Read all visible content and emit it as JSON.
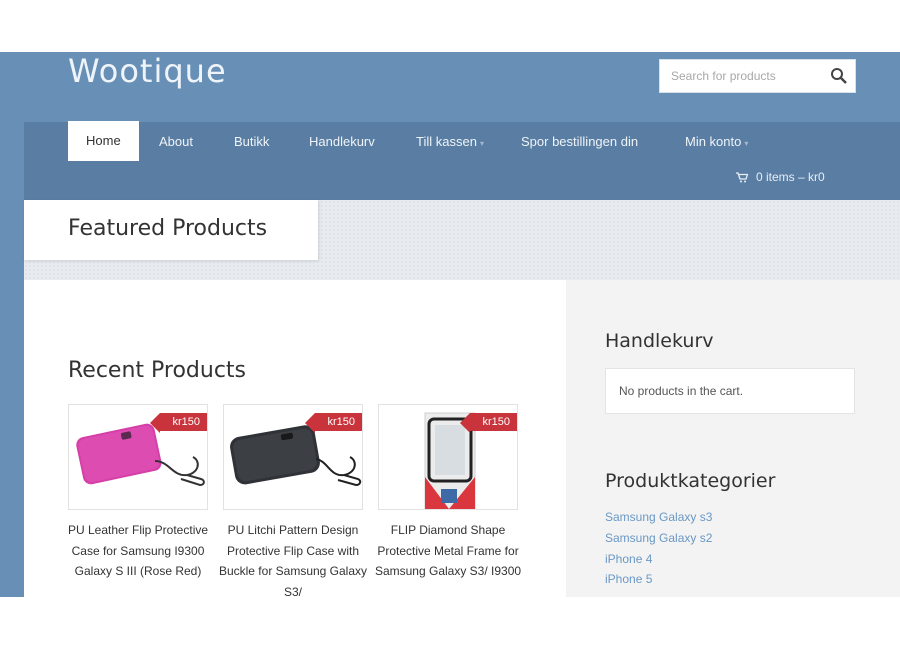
{
  "site": {
    "title": "Wootique"
  },
  "search": {
    "placeholder": "Search for products",
    "icon": "search-icon"
  },
  "nav": {
    "items": [
      {
        "label": "Home",
        "active": true,
        "dropdown": false
      },
      {
        "label": "About",
        "active": false,
        "dropdown": false
      },
      {
        "label": "Butikk",
        "active": false,
        "dropdown": false
      },
      {
        "label": "Handlekurv",
        "active": false,
        "dropdown": false
      },
      {
        "label": "Till kassen",
        "active": false,
        "dropdown": true
      },
      {
        "label": "Spor bestillingen din",
        "active": false,
        "dropdown": false
      },
      {
        "label": "Min konto",
        "active": false,
        "dropdown": true
      }
    ],
    "cart": {
      "text": "0 items – kr0",
      "icon": "cart-icon"
    }
  },
  "banner": {
    "title": "Featured Products"
  },
  "main": {
    "recent_heading": "Recent Products",
    "products": [
      {
        "title": "PU Leather Flip Protective Case for Samsung I9300 Galaxy S III (Rose Red)",
        "price": "kr150",
        "image": "pink-phone-case"
      },
      {
        "title": "PU Litchi Pattern Design Protective Flip Case with Buckle for Samsung Galaxy S3/",
        "price": "kr150",
        "image": "black-phone-case"
      },
      {
        "title": "FLIP Diamond Shape Protective Metal Frame for Samsung Galaxy S3/ I9300",
        "price": "kr150",
        "image": "metal-frame-package"
      }
    ]
  },
  "sidebar": {
    "cart_heading": "Handlekurv",
    "cart_empty": "No products in the cart.",
    "categories_heading": "Produktkategorier",
    "categories": [
      "Samsung Galaxy s3",
      "Samsung Galaxy s2",
      "iPhone 4",
      "iPhone 5"
    ]
  },
  "colors": {
    "header": "#6890b6",
    "nav": "#5a7ea3",
    "price_tag": "#c9343c",
    "link": "#6a98c4"
  }
}
